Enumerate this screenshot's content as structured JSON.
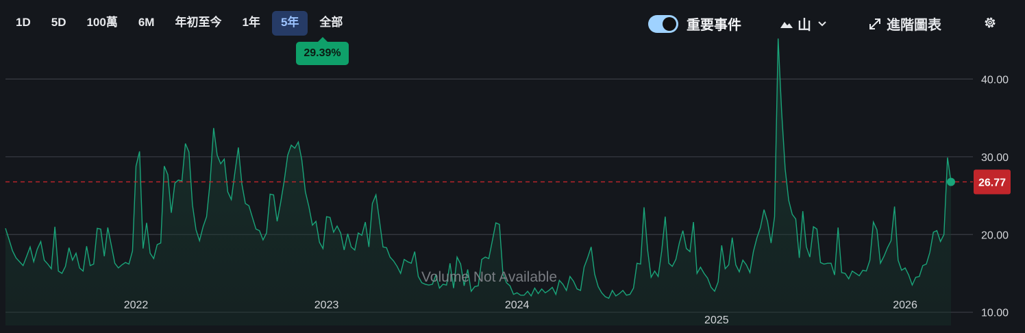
{
  "toolbar": {
    "ranges": [
      "1D",
      "5D",
      "100萬",
      "6M",
      "年初至今",
      "1年",
      "5年",
      "全部"
    ],
    "active_range": "5年",
    "change_badge": "29.39%",
    "events_label": "重要事件",
    "events_enabled": true,
    "chart_type_label": "山",
    "advanced_label": "進階圖表"
  },
  "colors": {
    "line": "#1aa57a",
    "fill": "#16352c",
    "reference": "#c2262b",
    "badge": "#0fa06a",
    "active_tab": "#263b66"
  },
  "chart_data": {
    "type": "area",
    "x_tick_labels": [
      "2022",
      "2023",
      "2024",
      "2025",
      "2026"
    ],
    "y_tick_labels": [
      "10.00",
      "20.00",
      "30.00",
      "40.00"
    ],
    "ylim": [
      8.3,
      46.2
    ],
    "reference_value": 26.77,
    "reference_label": "26.77",
    "watermark": "Volume Not Available",
    "grid": true,
    "values": [
      20.8,
      19.4,
      17.9,
      17.0,
      16.5,
      16.0,
      17.2,
      18.4,
      16.5,
      18.1,
      19.1,
      16.7,
      16.2,
      15.6,
      21.0,
      15.3,
      15.0,
      15.9,
      18.3,
      16.7,
      17.6,
      15.7,
      15.3,
      18.5,
      16.0,
      16.2,
      20.8,
      20.7,
      17.2,
      20.9,
      18.6,
      16.3,
      15.7,
      16.1,
      16.4,
      16.2,
      17.9,
      28.8,
      30.7,
      18.2,
      21.5,
      17.6,
      16.9,
      18.7,
      18.9,
      28.8,
      27.7,
      22.8,
      26.6,
      27.0,
      26.9,
      31.7,
      30.6,
      23.8,
      20.6,
      19.2,
      21.0,
      22.3,
      26.8,
      33.7,
      30.2,
      29.1,
      29.7,
      25.5,
      24.5,
      27.9,
      31.2,
      26.5,
      24.0,
      23.7,
      22.2,
      20.7,
      20.5,
      19.3,
      20.2,
      25.2,
      25.1,
      21.7,
      24.1,
      26.9,
      30.2,
      31.5,
      31.1,
      31.9,
      29.6,
      25.5,
      23.6,
      21.2,
      21.7,
      19.0,
      18.2,
      22.3,
      22.2,
      20.3,
      21.1,
      20.2,
      18.0,
      20.1,
      18.4,
      18.0,
      20.2,
      19.9,
      21.6,
      18.4,
      24.0,
      25.1,
      21.8,
      18.4,
      18.3,
      17.1,
      16.6,
      15.9,
      15.0,
      16.8,
      16.5,
      16.3,
      17.8,
      14.6,
      13.8,
      13.6,
      13.5,
      13.6,
      14.8,
      13.1,
      13.6,
      13.5,
      16.3,
      13.1,
      17.1,
      16.2,
      13.4,
      15.5,
      12.7,
      13.3,
      13.4,
      16.8,
      17.1,
      16.9,
      19.2,
      21.5,
      21.3,
      15.0,
      13.8,
      13.4,
      12.3,
      12.5,
      12.2,
      12.2,
      12.7,
      12.1,
      13.1,
      12.4,
      13.0,
      12.5,
      12.8,
      13.2,
      12.3,
      14.1,
      13.6,
      12.8,
      14.6,
      14.0,
      13.0,
      12.8,
      15.8,
      17.0,
      18.4,
      14.9,
      13.3,
      12.5,
      12.0,
      11.8,
      12.8,
      12.1,
      12.4,
      12.8,
      12.2,
      12.3,
      13.1,
      16.3,
      16.2,
      23.5,
      18.0,
      14.5,
      15.3,
      14.6,
      17.9,
      22.3,
      16.3,
      15.9,
      16.8,
      18.9,
      20.5,
      18.2,
      17.8,
      21.6,
      15.0,
      15.8,
      15.0,
      14.4,
      13.2,
      12.7,
      13.9,
      18.6,
      15.6,
      16.1,
      19.6,
      16.1,
      15.2,
      16.7,
      16.1,
      15.1,
      17.8,
      19.6,
      20.9,
      23.2,
      21.7,
      18.9,
      22.3,
      45.2,
      35.8,
      28.4,
      24.4,
      22.6,
      22.0,
      17.0,
      23.0,
      18.4,
      17.1,
      21.0,
      20.7,
      16.4,
      16.2,
      16.3,
      16.3,
      14.8,
      20.9,
      15.1,
      15.0,
      14.3,
      15.3,
      15.0,
      14.7,
      15.4,
      15.3,
      16.7,
      21.6,
      20.6,
      16.3,
      17.2,
      18.3,
      19.2,
      23.6,
      16.7,
      15.4,
      15.7,
      14.8,
      13.5,
      14.5,
      14.6,
      16.0,
      16.2,
      17.7,
      20.3,
      20.5,
      19.1,
      20.0,
      29.9,
      26.77
    ]
  }
}
